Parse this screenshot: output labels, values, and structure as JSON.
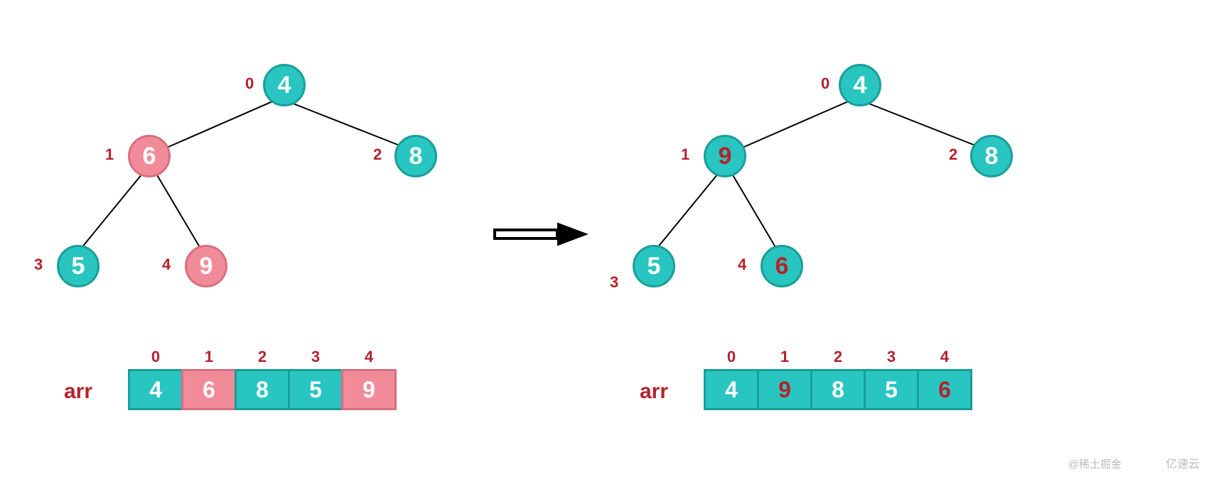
{
  "chart_data": [
    {
      "type": "tree",
      "title": "before",
      "nodes": [
        {
          "index": 0,
          "value": 4,
          "color": "teal"
        },
        {
          "index": 1,
          "value": 6,
          "color": "pink"
        },
        {
          "index": 2,
          "value": 8,
          "color": "teal"
        },
        {
          "index": 3,
          "value": 5,
          "color": "teal"
        },
        {
          "index": 4,
          "value": 9,
          "color": "pink"
        }
      ],
      "edges": [
        [
          0,
          1
        ],
        [
          0,
          2
        ],
        [
          1,
          3
        ],
        [
          1,
          4
        ]
      ],
      "array_label": "arr",
      "array": [
        {
          "index": 0,
          "value": 4,
          "color": "teal"
        },
        {
          "index": 1,
          "value": 6,
          "color": "pink"
        },
        {
          "index": 2,
          "value": 8,
          "color": "teal"
        },
        {
          "index": 3,
          "value": 5,
          "color": "teal"
        },
        {
          "index": 4,
          "value": 9,
          "color": "pink"
        }
      ]
    },
    {
      "type": "tree",
      "title": "after",
      "nodes": [
        {
          "index": 0,
          "value": 4,
          "color": "teal"
        },
        {
          "index": 1,
          "value": 9,
          "color": "teal",
          "value_color": "red"
        },
        {
          "index": 2,
          "value": 8,
          "color": "teal"
        },
        {
          "index": 3,
          "value": 5,
          "color": "teal"
        },
        {
          "index": 4,
          "value": 6,
          "color": "teal",
          "value_color": "red"
        }
      ],
      "edges": [
        [
          0,
          1
        ],
        [
          0,
          2
        ],
        [
          1,
          3
        ],
        [
          1,
          4
        ]
      ],
      "array_label": "arr",
      "array": [
        {
          "index": 0,
          "value": 4,
          "color": "teal"
        },
        {
          "index": 1,
          "value": 9,
          "color": "teal",
          "value_color": "red"
        },
        {
          "index": 2,
          "value": 8,
          "color": "teal"
        },
        {
          "index": 3,
          "value": 5,
          "color": "teal"
        },
        {
          "index": 4,
          "value": 6,
          "color": "teal",
          "value_color": "red"
        }
      ]
    }
  ],
  "left": {
    "arr_label": "arr",
    "n0": {
      "idx": "0",
      "val": "4"
    },
    "n1": {
      "idx": "1",
      "val": "6"
    },
    "n2": {
      "idx": "2",
      "val": "8"
    },
    "n3": {
      "idx": "3",
      "val": "5"
    },
    "n4": {
      "idx": "4",
      "val": "9"
    },
    "arr": [
      "4",
      "6",
      "8",
      "5",
      "9"
    ],
    "arr_idx": [
      "0",
      "1",
      "2",
      "3",
      "4"
    ]
  },
  "right": {
    "arr_label": "arr",
    "n0": {
      "idx": "0",
      "val": "4"
    },
    "n1": {
      "idx": "1",
      "val": "9"
    },
    "n2": {
      "idx": "2",
      "val": "8"
    },
    "n3": {
      "idx": "3",
      "val": "5"
    },
    "n4": {
      "idx": "4",
      "val": "6"
    },
    "arr": [
      "4",
      "9",
      "8",
      "5",
      "6"
    ],
    "arr_idx": [
      "0",
      "1",
      "2",
      "3",
      "4"
    ]
  },
  "watermark1": "亿速云",
  "watermark2": "@稀土掘金"
}
